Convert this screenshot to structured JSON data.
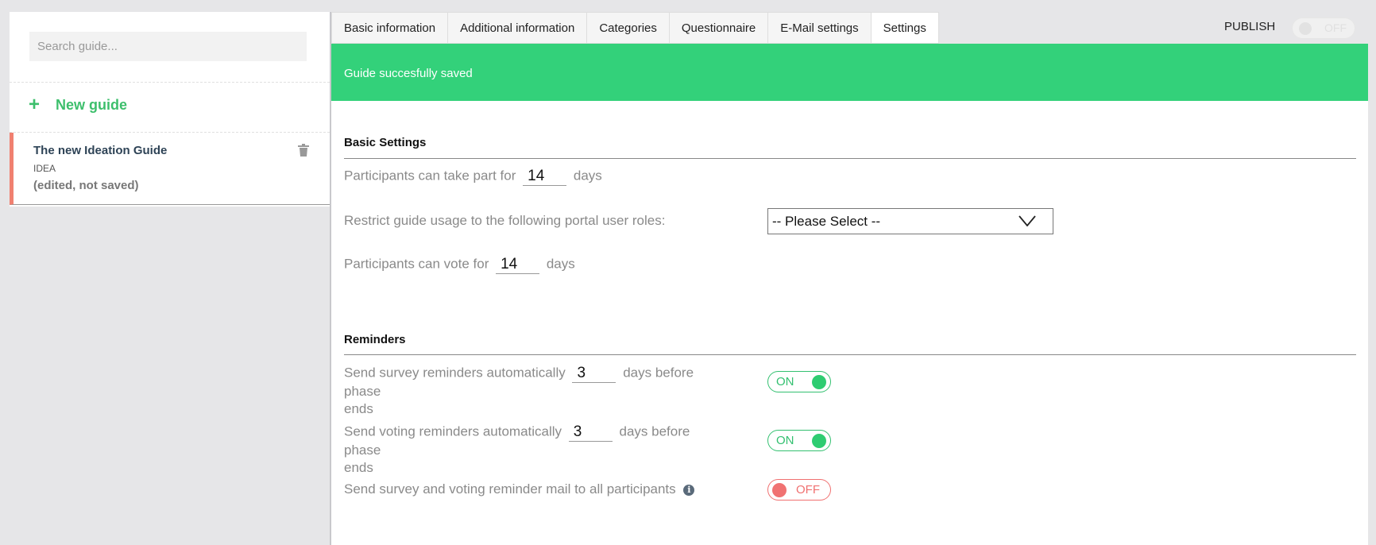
{
  "sidebar": {
    "search_placeholder": "Search guide...",
    "new_guide_label": "New guide",
    "guide": {
      "title": "The new Ideation Guide",
      "type": "IDEA",
      "status": "(edited, not saved)"
    }
  },
  "tabs": [
    {
      "label": "Basic information",
      "active": false
    },
    {
      "label": "Additional information",
      "active": false
    },
    {
      "label": "Categories",
      "active": false
    },
    {
      "label": "Questionnaire",
      "active": false
    },
    {
      "label": "E-Mail settings",
      "active": false
    },
    {
      "label": "Settings",
      "active": true
    }
  ],
  "publish": {
    "label": "PUBLISH",
    "toggle_text": "OFF"
  },
  "banner": {
    "message": "Guide succesfully saved",
    "color": "#33d17a"
  },
  "basic_settings": {
    "heading": "Basic Settings",
    "take_part": {
      "prefix": "Participants can take part for",
      "value": "14",
      "suffix": "days"
    },
    "restrict": {
      "label": "Restrict guide usage to the following portal user roles:",
      "selected": "-- Please Select --"
    },
    "vote": {
      "prefix": "Participants can vote for",
      "value": "14",
      "suffix": "days"
    }
  },
  "reminders": {
    "heading": "Reminders",
    "survey": {
      "prefix": "Send survey reminders automatically",
      "value": "3",
      "suffix_1": "days before phase",
      "suffix_2": "ends",
      "toggle": "ON"
    },
    "voting": {
      "prefix": "Send voting reminders automatically",
      "value": "3",
      "suffix_1": "days before phase",
      "suffix_2": "ends",
      "toggle": "ON"
    },
    "all_participants": {
      "label": "Send survey and voting reminder mail to all participants",
      "toggle": "OFF"
    }
  },
  "colors": {
    "accent_green": "#3dbf6c",
    "toggle_on": "#2ecc71",
    "toggle_off": "#f07272",
    "selected_marker": "#f08070"
  }
}
